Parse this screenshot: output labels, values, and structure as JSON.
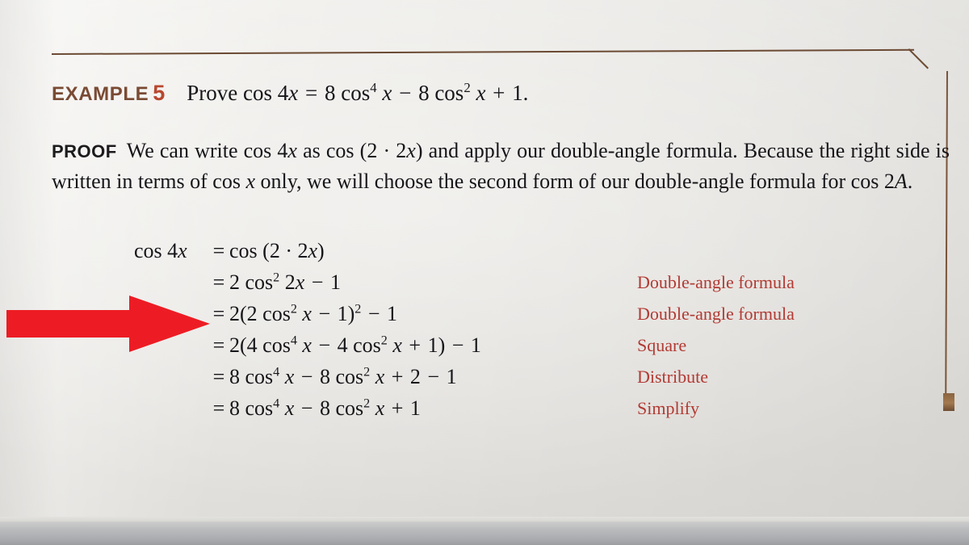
{
  "document": {
    "type": "textbook-page-photo",
    "example": {
      "kicker": "EXAMPLE",
      "number": "5",
      "statement_prefix": "Prove",
      "statement": "cos 4x = 8 cos⁴ x − 8 cos² x + 1."
    },
    "proof": {
      "kicker": "PROOF",
      "text": "We can write cos 4x as cos (2 · 2x) and apply our double-angle formula. Because the right side is written in terms of cos x only, we will choose the second form of our double-angle formula for cos 2A."
    },
    "derivation": {
      "rows": [
        {
          "lhs": "cos 4x",
          "rel": "=",
          "rhs": "cos (2 · 2x)",
          "reason": ""
        },
        {
          "lhs": "",
          "rel": "=",
          "rhs": "2 cos² 2x − 1",
          "reason": "Double-angle formula"
        },
        {
          "lhs": "",
          "rel": "=",
          "rhs": "2(2 cos² x − 1)² − 1",
          "reason": "Double-angle formula"
        },
        {
          "lhs": "",
          "rel": "=",
          "rhs": "2(4 cos⁴ x − 4 cos² x + 1) − 1",
          "reason": "Square"
        },
        {
          "lhs": "",
          "rel": "=",
          "rhs": "8 cos⁴ x − 8 cos² x + 2 − 1",
          "reason": "Distribute"
        },
        {
          "lhs": "",
          "rel": "=",
          "rhs": "8 cos⁴ x − 8 cos² x + 1",
          "reason": "Simplify"
        }
      ],
      "reasons": [
        "Double-angle formula",
        "Double-angle formula",
        "Square",
        "Distribute",
        "Simplify"
      ]
    },
    "annotation": {
      "kind": "arrow",
      "direction": "right",
      "color": "#ED1C24",
      "points_at_row": "2(2 cos² x − 1)² − 1"
    },
    "colors": {
      "example_kicker": "#7a4a33",
      "example_number": "#b8472e",
      "reason_text": "#b23a33",
      "rule_line": "#6b4a33",
      "body_text": "#16161a",
      "paper": "#eceae6",
      "arrow": "#ED1C24"
    }
  }
}
